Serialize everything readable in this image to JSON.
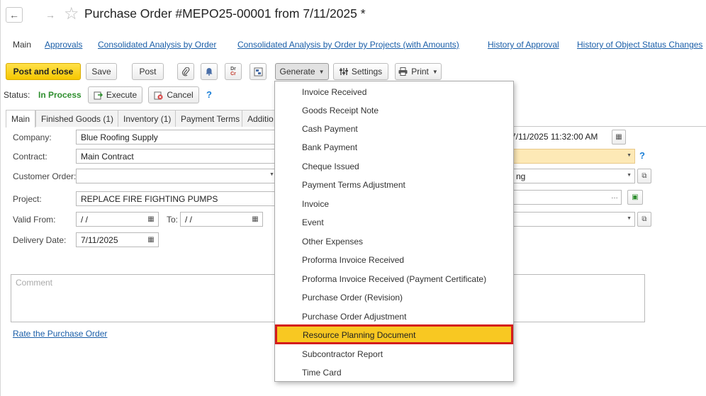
{
  "window": {
    "title": "Purchase Order #MEPO25-00001 from 7/11/2025 *"
  },
  "tabs": [
    {
      "label": "Main"
    },
    {
      "label": "Approvals"
    },
    {
      "label": "Consolidated Analysis by Order"
    },
    {
      "label": "Consolidated Analysis by Order by Projects (with Amounts)"
    },
    {
      "label": "History of Approval"
    },
    {
      "label": "History of Object Status Changes"
    }
  ],
  "toolbar": {
    "post_and_close": "Post and close",
    "save": "Save",
    "post": "Post",
    "dr_cr_top": "Dr",
    "dr_cr_bottom": "Cr",
    "generate": "Generate",
    "settings": "Settings",
    "print": "Print"
  },
  "status": {
    "label": "Status:",
    "value": "In Process",
    "execute": "Execute",
    "cancel": "Cancel",
    "help": "?"
  },
  "subtabs": [
    {
      "label": "Main"
    },
    {
      "label": "Finished Goods (1)"
    },
    {
      "label": "Inventory (1)"
    },
    {
      "label": "Payment Terms"
    },
    {
      "label": "Additio"
    }
  ],
  "form": {
    "company_label": "Company:",
    "company_value": "Blue Roofing Supply",
    "contract_label": "Contract:",
    "contract_value": "Main Contract",
    "customer_order_label": "Customer Order:",
    "customer_order_value": "",
    "project_label": "Project:",
    "project_value": "REPLACE FIRE FIGHTING PUMPS",
    "valid_from_label": "Valid From:",
    "valid_from_value": "/ /",
    "to_label": "To:",
    "to_value": "/ /",
    "delivery_date_label": "Delivery Date:",
    "delivery_date_value": "7/11/2025",
    "date_time_value": "7/11/2025 11:32:00 AM",
    "right_field3_value": "ng",
    "right_help": "?",
    "comment_placeholder": "Comment",
    "rate_link": "Rate the Purchase Order"
  },
  "generate_menu": {
    "items": [
      {
        "label": "Invoice Received"
      },
      {
        "label": "Goods Receipt Note"
      },
      {
        "label": "Cash Payment"
      },
      {
        "label": "Bank Payment"
      },
      {
        "label": "Cheque Issued"
      },
      {
        "label": "Payment Terms Adjustment"
      },
      {
        "label": "Invoice"
      },
      {
        "label": "Event"
      },
      {
        "label": "Other Expenses"
      },
      {
        "label": "Proforma Invoice Received"
      },
      {
        "label": "Proforma Invoice Received (Payment Certificate)"
      },
      {
        "label": "Purchase Order (Revision)"
      },
      {
        "label": "Purchase Order Adjustment"
      },
      {
        "label": "Resource Planning Document"
      },
      {
        "label": "Subcontractor Report"
      },
      {
        "label": "Time Card"
      }
    ],
    "highlighted": "Resource Planning Document"
  },
  "colors": {
    "primary_button": "#f6c700",
    "status_green": "#2f8f2f",
    "link_blue": "#1a5ea8",
    "highlight_yellow": "#f8c822",
    "highlight_border_red": "#d41c1c",
    "required_field_yellow": "#fde9b6"
  },
  "icons": {
    "back": "arrow-left-icon",
    "forward": "arrow-right-icon",
    "favorite": "star-icon",
    "attach": "paperclip-icon",
    "notify": "bell-icon",
    "dr_cr": "dr-cr-icon",
    "structure": "document-structure-icon",
    "settings": "settings-icon",
    "print": "printer-icon",
    "execute": "execute-icon",
    "cancel": "cancel-icon",
    "calendar": "calendar-icon"
  }
}
